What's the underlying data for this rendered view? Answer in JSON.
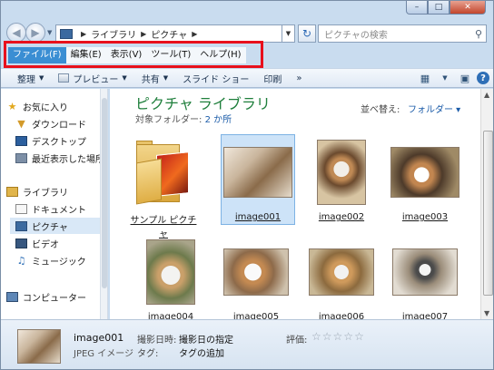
{
  "window": {
    "min_symbol": "–",
    "max_symbol": "□",
    "close_symbol": "✕"
  },
  "address": {
    "crumbs": [
      "ライブラリ",
      "ピクチャ"
    ],
    "search_placeholder": "ピクチャの検索"
  },
  "menu": {
    "items": [
      "ファイル(F)",
      "編集(E)",
      "表示(V)",
      "ツール(T)",
      "ヘルプ(H)"
    ],
    "active_index": 0,
    "highlight_color": "#e8101c"
  },
  "toolbar": {
    "organize": "整理",
    "preview": "プレビュー",
    "share": "共有",
    "slideshow": "スライド ショー",
    "print": "印刷",
    "more": "»"
  },
  "sidebar": {
    "favorites": "お気に入り",
    "downloads": "ダウンロード",
    "desktop": "デスクトップ",
    "recent": "最近表示した場所",
    "libraries": "ライブラリ",
    "documents": "ドキュメント",
    "pictures": "ピクチャ",
    "videos": "ビデオ",
    "music": "ミュージック",
    "computer": "コンピューター"
  },
  "main": {
    "title": "ピクチャ ライブラリ",
    "subtitle_label": "対象フォルダー:",
    "subtitle_link": "2 か所",
    "sort_label": "並べ替え:",
    "sort_value": "フォルダー ▾",
    "folder_caption": "サンプル ピクチャ",
    "items": [
      "image001",
      "image002",
      "image003",
      "image004",
      "image005",
      "image006",
      "image007"
    ],
    "selected_item": "image001"
  },
  "details": {
    "name": "image001",
    "type": "JPEG イメージ",
    "date_label": "撮影日時:",
    "date_value": "撮影日の指定",
    "tag_label": "タグ:",
    "tag_value": "タグの追加",
    "rating_label": "評価:",
    "rating": 0,
    "rating_max": 5
  }
}
